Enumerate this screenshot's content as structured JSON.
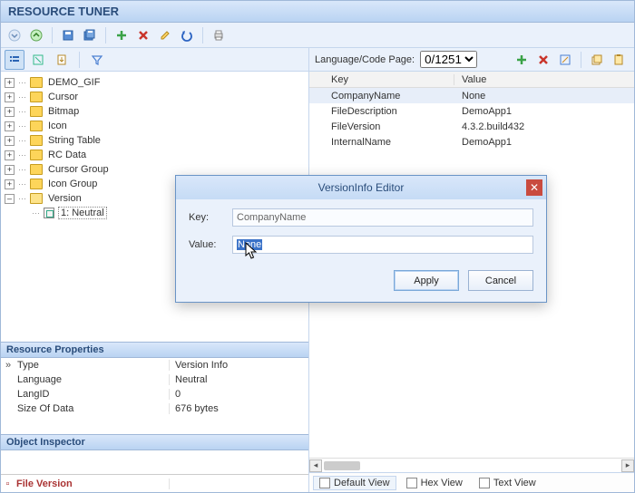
{
  "app_title": "RESOURCE TUNER",
  "toolbar": {
    "down_icon": "down-arrow",
    "up_icon": "up-arrow",
    "save_icon": "save",
    "saveall_icon": "save-all",
    "add_icon": "plus",
    "delete_icon": "delete",
    "edit_icon": "edit",
    "undo_icon": "undo",
    "print_icon": "print"
  },
  "tree_toolbar": {
    "list_icon": "list",
    "refresh_icon": "refresh",
    "export_icon": "export",
    "filter_icon": "filter"
  },
  "tree": [
    {
      "label": "DEMO_GIF",
      "expandable": true,
      "expanded": false
    },
    {
      "label": "Cursor",
      "expandable": true,
      "expanded": false
    },
    {
      "label": "Bitmap",
      "expandable": true,
      "expanded": false
    },
    {
      "label": "Icon",
      "expandable": true,
      "expanded": false
    },
    {
      "label": "String Table",
      "expandable": true,
      "expanded": false
    },
    {
      "label": "RC Data",
      "expandable": true,
      "expanded": false
    },
    {
      "label": "Cursor Group",
      "expandable": true,
      "expanded": false
    },
    {
      "label": "Icon Group",
      "expandable": true,
      "expanded": false
    },
    {
      "label": "Version",
      "expandable": true,
      "expanded": true,
      "children": [
        {
          "label": "1: Neutral",
          "icon": "resource",
          "selected": true
        }
      ]
    }
  ],
  "props_header": "Resource Properties",
  "props": [
    {
      "k": "Type",
      "v": "Version Info",
      "marker": "»"
    },
    {
      "k": "Language",
      "v": "Neutral",
      "marker": ""
    },
    {
      "k": "LangID",
      "v": "0",
      "marker": ""
    },
    {
      "k": "Size Of Data",
      "v": "676 bytes",
      "marker": ""
    }
  ],
  "inspector_header": "Object Inspector",
  "file_version_label": "File Version",
  "right": {
    "lang_label": "Language/Code Page:",
    "lang_value": "0/1251",
    "key_header": "Key",
    "value_header": "Value",
    "rows": [
      {
        "k": "CompanyName",
        "v": "None",
        "selected": true
      },
      {
        "k": "FileDescription",
        "v": "DemoApp1"
      },
      {
        "k": "FileVersion",
        "v": "4.3.2.build432"
      },
      {
        "k": "InternalName",
        "v": "DemoApp1"
      }
    ],
    "tabs": {
      "default": "Default View",
      "hex": "Hex View",
      "text": "Text View"
    }
  },
  "dialog": {
    "title": "VersionInfo Editor",
    "key_label": "Key:",
    "key_value": "CompanyName",
    "value_label": "Value:",
    "value_text": "None",
    "apply": "Apply",
    "cancel": "Cancel"
  }
}
